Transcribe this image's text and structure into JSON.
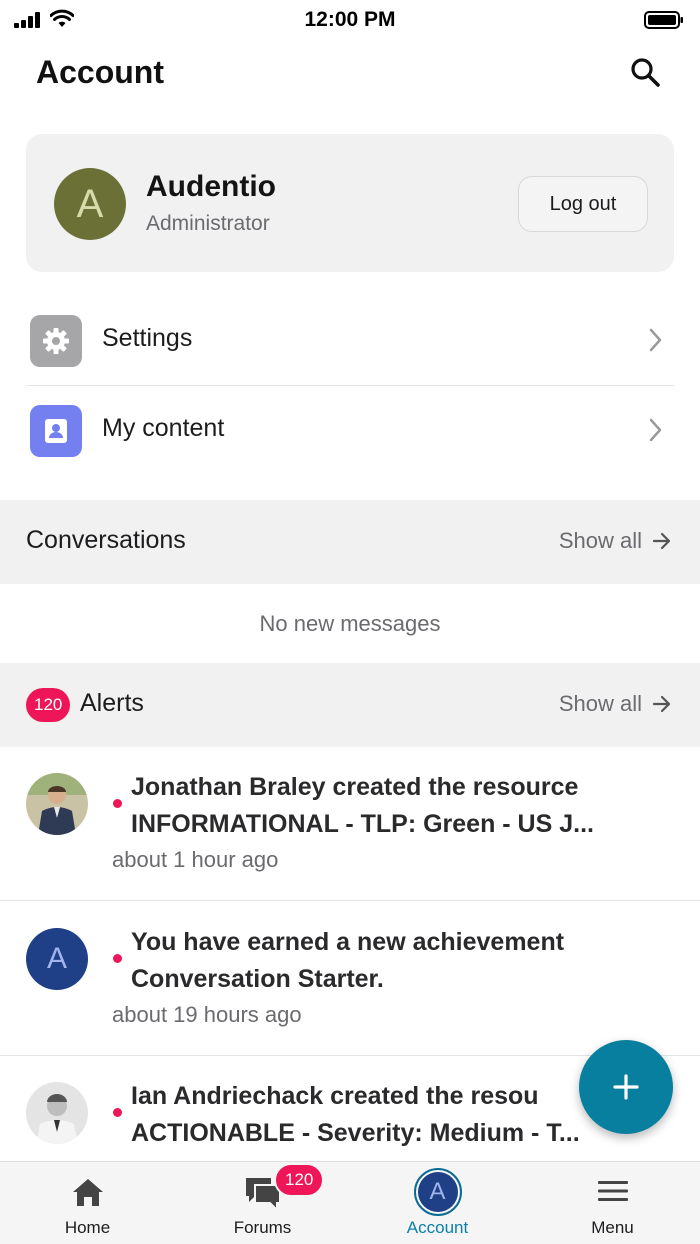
{
  "status_bar": {
    "time": "12:00 PM"
  },
  "header": {
    "title": "Account"
  },
  "profile": {
    "initial": "A",
    "name": "Audentio",
    "role": "Administrator",
    "logout_label": "Log out",
    "avatar_color": "#6b7136"
  },
  "menu": {
    "items": [
      {
        "label": "Settings",
        "icon": "gear-icon",
        "icon_color": "#a6a6a8"
      },
      {
        "label": "My content",
        "icon": "profile-card-icon",
        "icon_color": "#7480f0"
      }
    ]
  },
  "conversations": {
    "title": "Conversations",
    "show_all": "Show all",
    "empty": "No new messages"
  },
  "alerts": {
    "badge": "120",
    "title": "Alerts",
    "show_all": "Show all",
    "items": [
      {
        "line1": "Jonathan Braley created the resource",
        "line2": "INFORMATIONAL - TLP: Green - US J...",
        "time": "about 1 hour ago",
        "avatar": "photo"
      },
      {
        "line1": "You have earned a new achievement",
        "line2": "Conversation Starter.",
        "time": "about 19 hours ago",
        "avatar": "A"
      },
      {
        "line1": "Ian Andriechack created the resou",
        "line2": "ACTIONABLE - Severity: Medium - T...",
        "time": "",
        "avatar": "photo"
      }
    ]
  },
  "fab": {
    "icon": "plus-icon",
    "color": "#087f9e"
  },
  "tab_bar": {
    "tabs": [
      {
        "label": "Home",
        "icon": "home-icon"
      },
      {
        "label": "Forums",
        "icon": "forums-icon"
      },
      {
        "label": "Account",
        "icon": "avatar",
        "initial": "A",
        "active": true
      },
      {
        "label": "Menu",
        "icon": "hamburger-icon"
      }
    ],
    "account_badge": "120"
  },
  "colors": {
    "accent": "#0b7fa8",
    "badge": "#ee1558"
  }
}
